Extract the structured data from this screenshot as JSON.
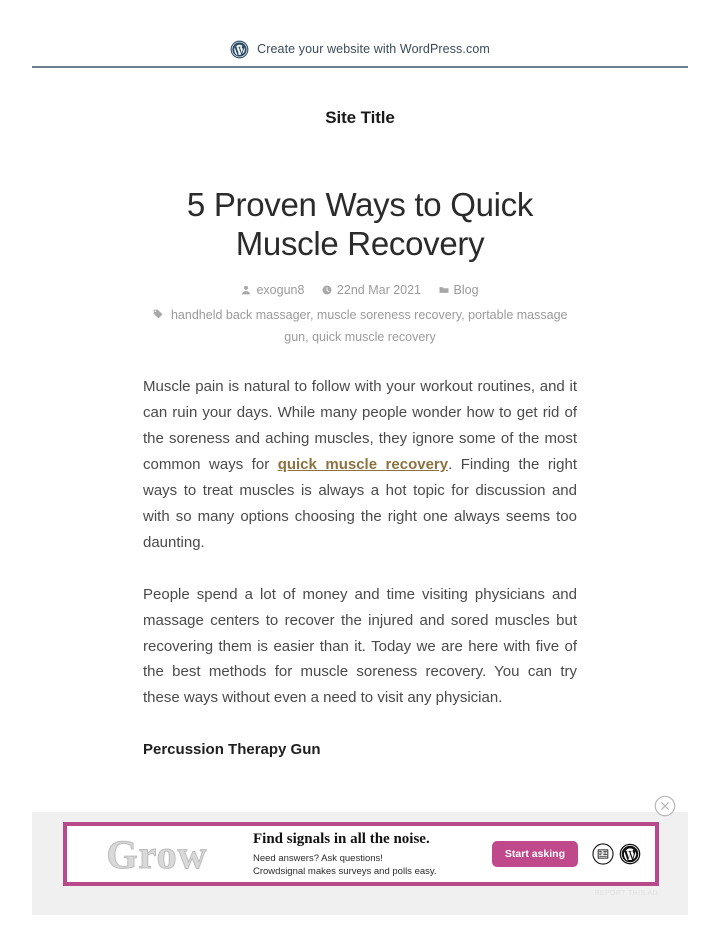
{
  "promo_bar": {
    "icon": "wordpress-logo-icon",
    "label": "Create your website with WordPress.com"
  },
  "site": {
    "title": "Site Title"
  },
  "post": {
    "title": "5 Proven Ways to Quick Muscle Recovery",
    "meta": {
      "author": "exogun8",
      "author_icon": "person-icon",
      "date": "22nd Mar 2021",
      "date_icon": "clock-icon",
      "category": "Blog",
      "category_icon": "folder-icon",
      "tags_icon": "tag-icon",
      "tags": "handheld back massager, muscle soreness recovery, portable massage gun, quick muscle recovery"
    },
    "paragraph_1_part_1": "Muscle pain is natural to follow with your workout routines, and it can ruin your days. While many people wonder how to get rid of the soreness and aching muscles, they ignore some of the most common ways for ",
    "paragraph_1_link": "quick muscle recovery",
    "paragraph_1_part_2": ". Finding the right ways to treat muscles is always a hot topic for discussion and with so many options choosing the right one always seems too daunting.",
    "paragraph_2": "People spend a lot of money and time visiting physicians and massage centers to recover the injured and sored muscles but recovering them is easier than it. Today we are here with five of the best methods for muscle soreness recovery. You can try these ways without even a need to visit any physician.",
    "subheading": "Percussion Therapy Gun"
  },
  "ad": {
    "close_icon": "close-circle-icon",
    "image_word": "Grow",
    "headline": "Find signals in all the noise.",
    "sub_line_1": "Need answers? Ask questions!",
    "sub_line_2": "Crowdsignal makes surveys and polls easy.",
    "cta_label": "Start asking",
    "brand_icon_1": "crowdsignal-logo-icon",
    "brand_icon_2": "wordpress-logo-icon",
    "report_label": "REPORT THIS AD"
  },
  "colors": {
    "promo_border": "#6d7f8e",
    "link": "#8a7340",
    "ad_border": "#b84a8c",
    "ad_cta": "#c0498b"
  }
}
